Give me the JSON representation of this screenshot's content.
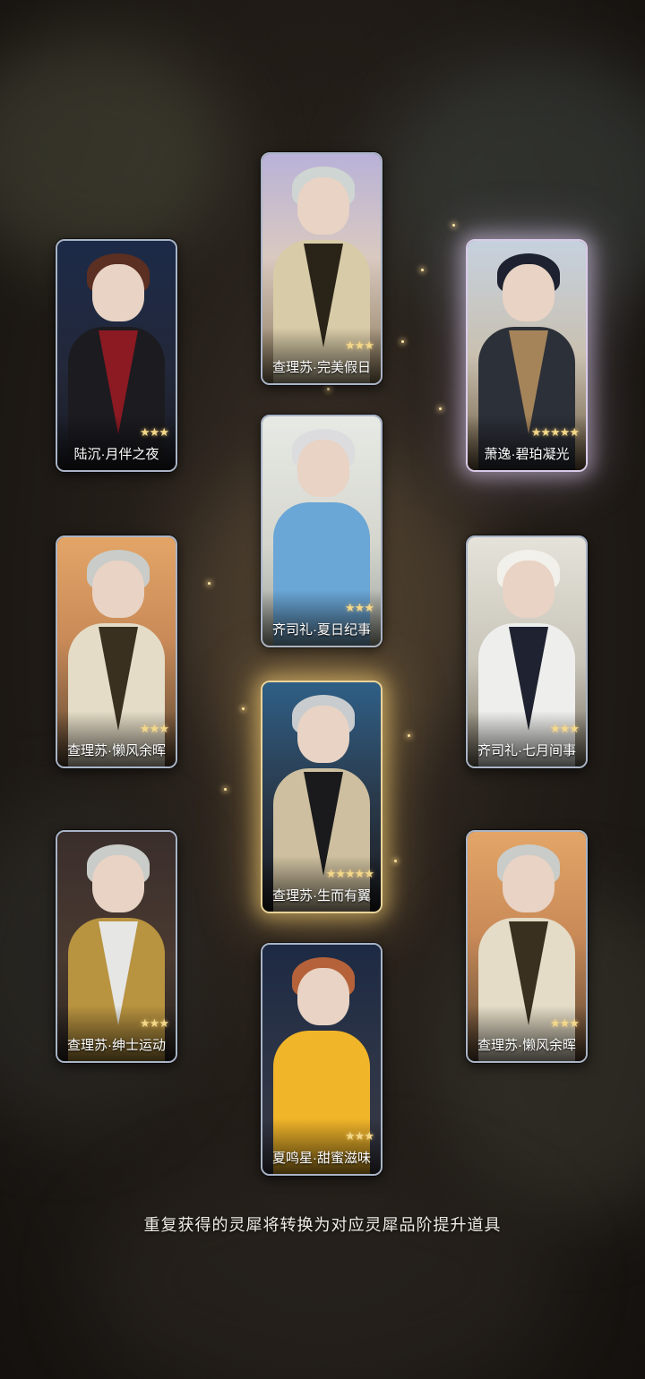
{
  "cards": [
    {
      "name": "陆沉·月伴之夜",
      "stars": "★★★",
      "rarity": 3
    },
    {
      "name": "查理苏·完美假日",
      "stars": "★★★",
      "rarity": 3
    },
    {
      "name": "萧逸·碧珀凝光",
      "stars": "★★★★★",
      "rarity": 5
    },
    {
      "name": "齐司礼·夏日纪事",
      "stars": "★★★",
      "rarity": 3
    },
    {
      "name": "查理苏·懒风余晖",
      "stars": "★★★",
      "rarity": 3
    },
    {
      "name": "齐司礼·七月间事",
      "stars": "★★★",
      "rarity": 3
    },
    {
      "name": "查理苏·生而有翼",
      "stars": "★★★★★",
      "rarity": 5
    },
    {
      "name": "查理苏·绅士运动",
      "stars": "★★★",
      "rarity": 3
    },
    {
      "name": "查理苏·懒风余晖",
      "stars": "★★★",
      "rarity": 3
    },
    {
      "name": "夏鸣星·甜蜜滋味",
      "stars": "★★★",
      "rarity": 3
    }
  ],
  "footer": {
    "note": "重复获得的灵犀将转换为对应灵犀品阶提升道具"
  },
  "colors": {
    "star": "#f3d88a",
    "gold_glow": "#e9d39a",
    "violet_glow": "#d9cbe9",
    "frame": "#a9b4c6"
  }
}
